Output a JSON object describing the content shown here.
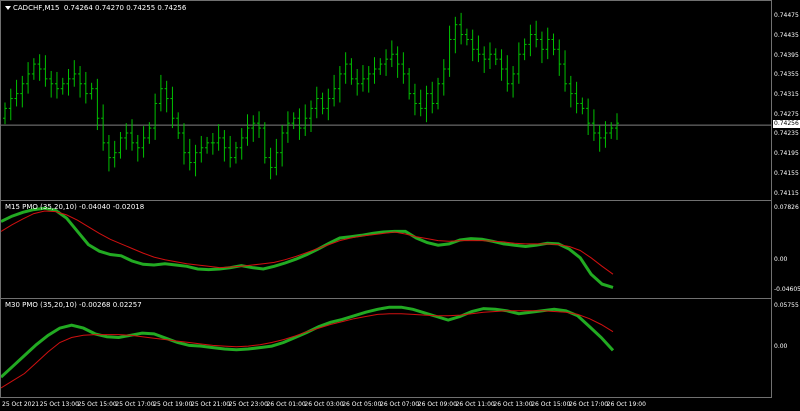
{
  "header": {
    "symbol_text": "CADCHF,M15",
    "ohlc": "0.74264 0.74270 0.74255 0.74256"
  },
  "main": {
    "price_axis": [
      "0.74475",
      "0.74435",
      "0.74395",
      "0.74355",
      "0.74315",
      "0.74275",
      "0.74235",
      "0.74195",
      "0.74155",
      "0.74115"
    ],
    "current_price": "0.74256",
    "candle_color": "#00c000",
    "bid_line_color": "#808080"
  },
  "ind1": {
    "title": "M15 PMO (35,20,10) -0.04040 -0.02018",
    "axis": [
      "0.07826",
      "0.00",
      "-0.04605"
    ],
    "pmo_color": "#22aa22",
    "signal_color": "#d01010"
  },
  "ind2": {
    "title": "M30 PMO (35,20,10) -0.00268 0.02257",
    "axis": [
      "0.05755",
      "0.00"
    ],
    "pmo_color": "#22aa22",
    "signal_color": "#d01010"
  },
  "time_axis": [
    "25 Oct 2021",
    "25 Oct 13:00",
    "25 Oct 15:00",
    "25 Oct 17:00",
    "25 Oct 19:00",
    "25 Oct 21:00",
    "25 Oct 23:00",
    "26 Oct 01:00",
    "26 Oct 03:00",
    "26 Oct 05:00",
    "26 Oct 07:00",
    "26 Oct 09:00",
    "26 Oct 11:00",
    "26 Oct 13:00",
    "26 Oct 15:00",
    "26 Oct 17:00",
    "26 Oct 19:00"
  ],
  "chart_data": [
    {
      "type": "candlestick",
      "title": "CADCHF,M15",
      "ylim": [
        0.7411,
        0.745
      ],
      "close": [
        0.7429,
        0.7431,
        0.7432,
        0.7434,
        0.7436,
        0.7438,
        0.7437,
        0.7435,
        0.7434,
        0.7433,
        0.7434,
        0.7435,
        0.7436,
        0.7434,
        0.7432,
        0.7433,
        0.7427,
        0.7422,
        0.7419,
        0.742,
        0.7423,
        0.7424,
        0.7422,
        0.7421,
        0.7423,
        0.7425,
        0.743,
        0.7433,
        0.7431,
        0.7427,
        0.7424,
        0.742,
        0.7418,
        0.742,
        0.7421,
        0.7422,
        0.7422,
        0.7423,
        0.7421,
        0.7419,
        0.7421,
        0.7423,
        0.7425,
        0.7426,
        0.7425,
        0.7419,
        0.7417,
        0.742,
        0.7424,
        0.7426,
        0.7427,
        0.7425,
        0.7427,
        0.7429,
        0.7431,
        0.7429,
        0.7431,
        0.7433,
        0.7436,
        0.7438,
        0.7435,
        0.7434,
        0.7435,
        0.7436,
        0.7437,
        0.7438,
        0.7439,
        0.744,
        0.7438,
        0.7436,
        0.7432,
        0.743,
        0.7429,
        0.7432,
        0.743,
        0.7434,
        0.7437,
        0.7443,
        0.7446,
        0.7444,
        0.7443,
        0.7441,
        0.744,
        0.7439,
        0.744,
        0.7439,
        0.7437,
        0.7434,
        0.7436,
        0.744,
        0.7442,
        0.7444,
        0.7443,
        0.7441,
        0.7443,
        0.7441,
        0.7438,
        0.7434,
        0.7432,
        0.743,
        0.7429,
        0.7426,
        0.7424,
        0.7423,
        0.7424,
        0.7425,
        0.7426
      ]
    },
    {
      "type": "line",
      "title": "M15 PMO (35,20,10) -0.04040 -0.02018",
      "series": [
        {
          "values": [
            0.06,
            0.068,
            0.074,
            0.078,
            0.08,
            0.077,
            0.065,
            0.045,
            0.025,
            0.015,
            0.01,
            0.008,
            0.0,
            -0.005,
            -0.006,
            -0.004,
            -0.006,
            -0.008,
            -0.012,
            -0.013,
            -0.012,
            -0.01,
            -0.007,
            -0.01,
            -0.012,
            -0.008,
            -0.003,
            0.003,
            0.01,
            0.018,
            0.027,
            0.035,
            0.037,
            0.039,
            0.042,
            0.044,
            0.045,
            0.045,
            0.035,
            0.028,
            0.024,
            0.026,
            0.032,
            0.034,
            0.033,
            0.03,
            0.026,
            0.024,
            0.022,
            0.024,
            0.027,
            0.026,
            0.018,
            0.005,
            -0.02,
            -0.035,
            -0.04
          ]
        },
        {
          "values": [
            0.045,
            0.055,
            0.064,
            0.072,
            0.076,
            0.075,
            0.07,
            0.062,
            0.052,
            0.042,
            0.033,
            0.026,
            0.019,
            0.012,
            0.006,
            0.002,
            -0.001,
            -0.004,
            -0.006,
            -0.008,
            -0.01,
            -0.009,
            -0.008,
            -0.006,
            -0.004,
            -0.002,
            0.002,
            0.007,
            0.013,
            0.019,
            0.025,
            0.031,
            0.035,
            0.038,
            0.04,
            0.042,
            0.044,
            0.041,
            0.037,
            0.034,
            0.031,
            0.03,
            0.031,
            0.031,
            0.031,
            0.03,
            0.029,
            0.027,
            0.026,
            0.026,
            0.026,
            0.025,
            0.022,
            0.016,
            0.005,
            -0.008,
            -0.02
          ]
        }
      ]
    },
    {
      "type": "line",
      "title": "M30 PMO (35,20,10) -0.00268 0.02257",
      "series": [
        {
          "values": [
            -0.04,
            -0.025,
            -0.01,
            0.005,
            0.018,
            0.028,
            0.032,
            0.028,
            0.02,
            0.016,
            0.015,
            0.018,
            0.021,
            0.02,
            0.014,
            0.008,
            0.004,
            0.003,
            0.001,
            -0.001,
            -0.002,
            -0.001,
            0.001,
            0.003,
            0.008,
            0.015,
            0.022,
            0.03,
            0.036,
            0.04,
            0.045,
            0.05,
            0.054,
            0.057,
            0.057,
            0.054,
            0.049,
            0.044,
            0.039,
            0.044,
            0.051,
            0.055,
            0.054,
            0.052,
            0.048,
            0.05,
            0.052,
            0.054,
            0.052,
            0.045,
            0.03,
            0.015,
            -0.003
          ]
        },
        {
          "values": [
            -0.055,
            -0.045,
            -0.035,
            -0.02,
            -0.005,
            0.008,
            0.015,
            0.018,
            0.019,
            0.019,
            0.019,
            0.018,
            0.016,
            0.014,
            0.012,
            0.01,
            0.008,
            0.006,
            0.004,
            0.003,
            0.002,
            0.003,
            0.005,
            0.008,
            0.012,
            0.017,
            0.023,
            0.028,
            0.033,
            0.037,
            0.041,
            0.044,
            0.047,
            0.048,
            0.048,
            0.047,
            0.046,
            0.045,
            0.045,
            0.046,
            0.048,
            0.05,
            0.051,
            0.052,
            0.052,
            0.052,
            0.052,
            0.051,
            0.05,
            0.047,
            0.041,
            0.033,
            0.023
          ]
        }
      ]
    }
  ]
}
